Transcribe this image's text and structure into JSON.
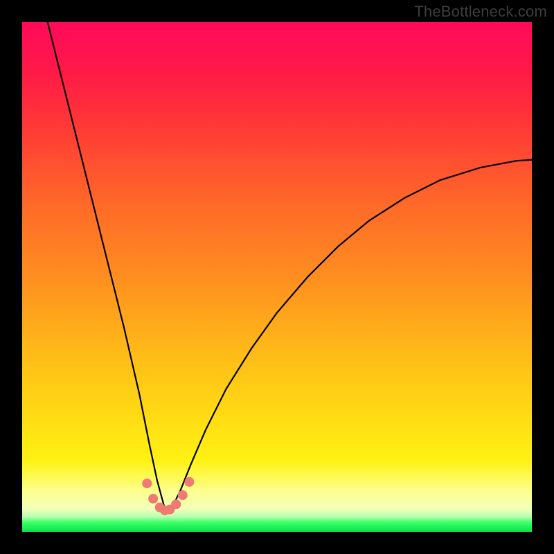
{
  "watermark": "TheBottleneck.com",
  "chart_data": {
    "type": "line",
    "title": "",
    "xlabel": "",
    "ylabel": "",
    "xlim": [
      0,
      100
    ],
    "ylim": [
      0,
      100
    ],
    "grid": false,
    "legend": false,
    "notes": "Background is a vertical red→green gradient; a black V-shaped curve drops from top-left to a minimum near x≈28 then rises to the right edge near y≈73. Small salmon dots cluster at the curve bottom.",
    "series": [
      {
        "name": "curve",
        "color": "#000000",
        "x": [
          5,
          8,
          11,
          14,
          17,
          20,
          23,
          25,
          26.5,
          28,
          29.5,
          31,
          33,
          36,
          40,
          45,
          50,
          56,
          62,
          68,
          75,
          82,
          90,
          97,
          100
        ],
        "y": [
          100,
          88,
          76,
          64,
          52,
          40,
          27,
          17,
          10,
          4.5,
          5,
          8,
          13,
          20,
          28,
          36,
          43,
          50,
          56,
          61,
          65.5,
          69,
          71.5,
          72.8,
          73
        ]
      }
    ],
    "markers": {
      "name": "bottom-dots",
      "color": "#ef7a73",
      "radius_px": 7,
      "x": [
        24.5,
        25.7,
        27,
        28,
        29,
        30.2,
        31.5,
        32.8
      ],
      "y": [
        9.5,
        6.5,
        4.8,
        4.2,
        4.4,
        5.4,
        7.2,
        9.8
      ]
    }
  }
}
